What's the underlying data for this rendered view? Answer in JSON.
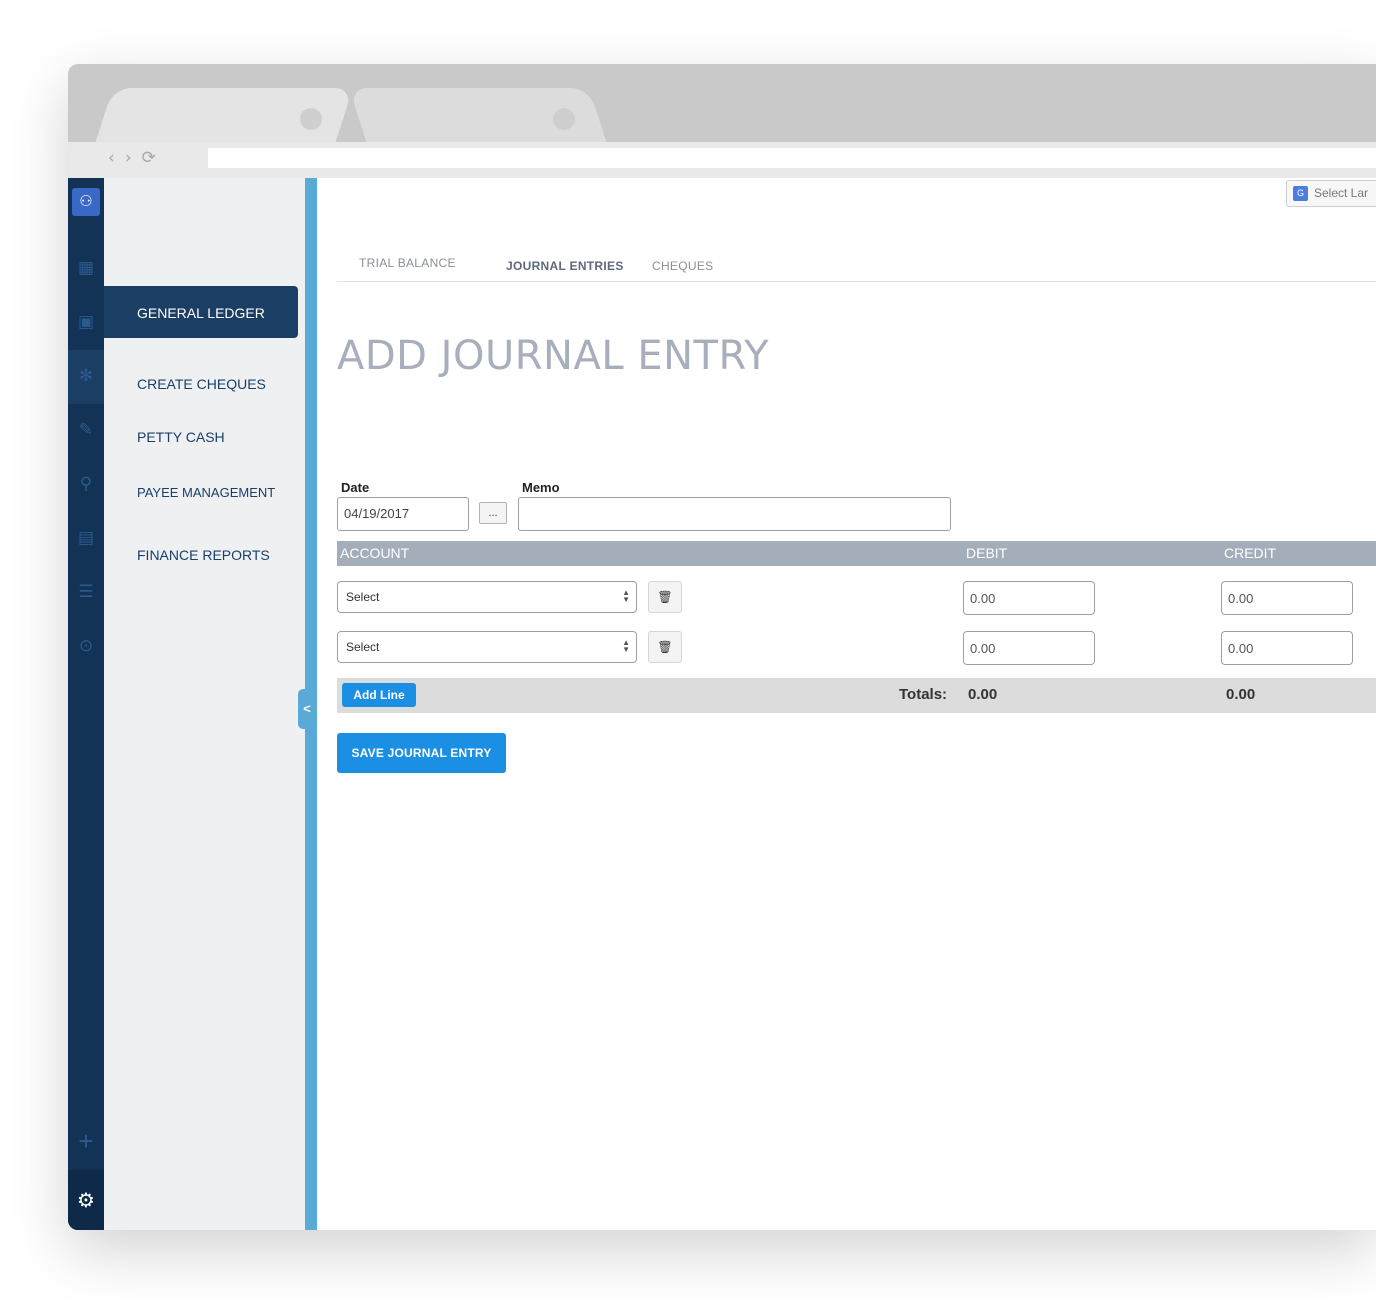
{
  "colors": {
    "rail_bg": "#133356",
    "sidebar_bg": "#eff0f2",
    "active_nav": "#1b3e64",
    "divider": "#5aaad8",
    "table_header": "#a4aeba",
    "primary_button": "#1a8fe4"
  },
  "icons": {
    "logo": "family-icon",
    "rail": [
      "apps-grid-icon",
      "briefcase-icon",
      "snowflake-icon",
      "tools-icon",
      "search-icon",
      "chart-icon",
      "list-icon",
      "play-circle-icon"
    ],
    "rail_bottom": [
      "plus-icon",
      "gear-icon"
    ],
    "language": "google-translate-icon"
  },
  "language_select": {
    "label": "Select Lar"
  },
  "sidebar": {
    "items": [
      {
        "label": "GENERAL LEDGER",
        "active": true
      },
      {
        "label": "CREATE CHEQUES"
      },
      {
        "label": "PETTY CASH"
      },
      {
        "label": "PAYEE MANAGEMENT"
      },
      {
        "label": "FINANCE REPORTS"
      }
    ],
    "collapse_label": "<"
  },
  "tabs": [
    {
      "label": "TRIAL BALANCE"
    },
    {
      "label": "JOURNAL ENTRIES",
      "active": true
    },
    {
      "label": "CHEQUES"
    }
  ],
  "page_title": "ADD JOURNAL ENTRY",
  "form": {
    "date_label": "Date",
    "date_value": "04/19/2017",
    "date_picker_label": "...",
    "memo_label": "Memo",
    "memo_value": ""
  },
  "table": {
    "headers": {
      "account": "ACCOUNT",
      "debit": "DEBIT",
      "credit": "CREDIT"
    },
    "rows": [
      {
        "account": "Select",
        "debit": "0.00",
        "credit": "0.00"
      },
      {
        "account": "Select",
        "debit": "0.00",
        "credit": "0.00"
      }
    ]
  },
  "totals": {
    "add_line_label": "Add Line",
    "label": "Totals:",
    "debit": "0.00",
    "credit": "0.00"
  },
  "save_label": "SAVE JOURNAL ENTRY"
}
